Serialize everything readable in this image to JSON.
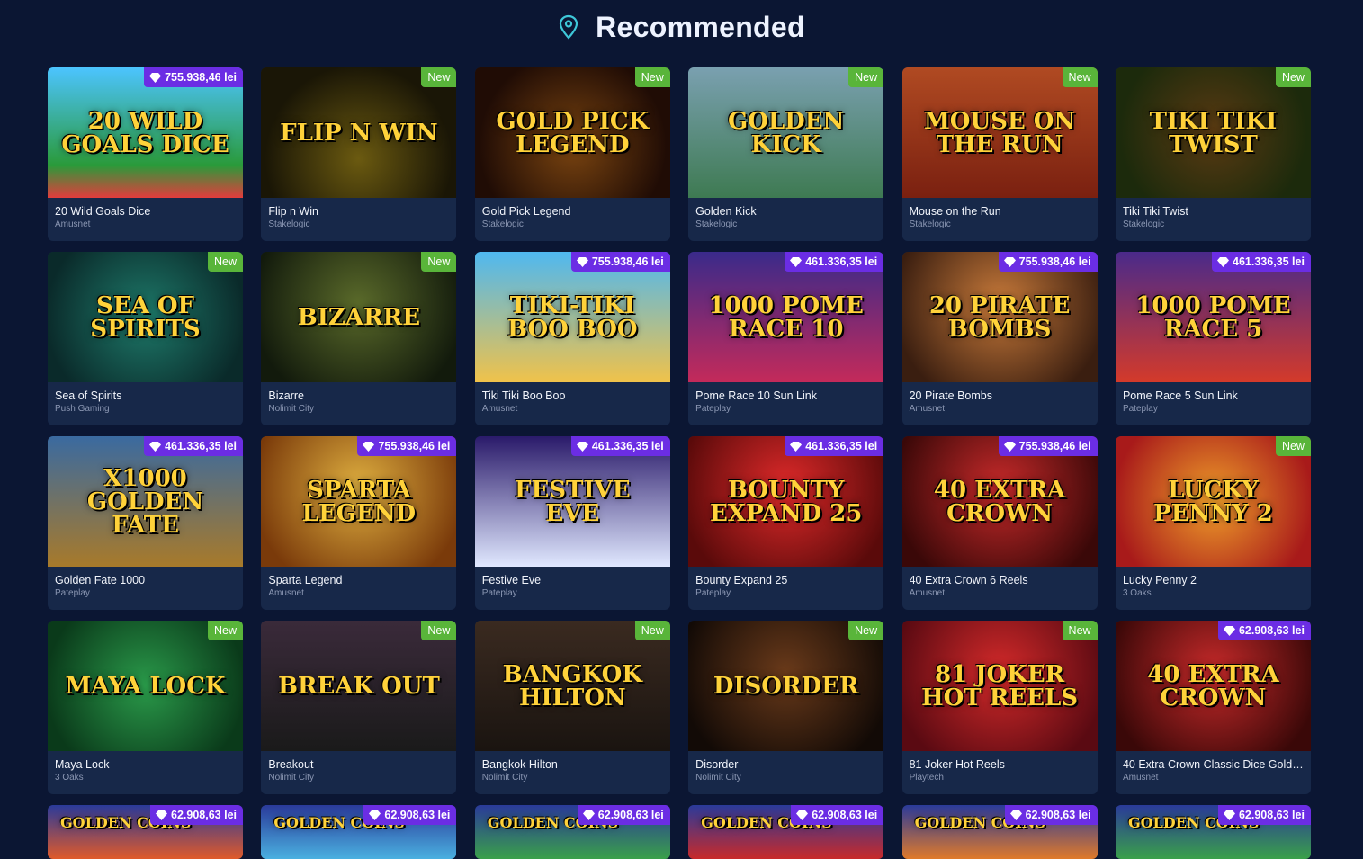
{
  "header": {
    "title": "Recommended",
    "icon": "location-pin-icon"
  },
  "colors": {
    "background": "#0b1633",
    "card": "#172849",
    "new_badge": "#59b53a",
    "jackpot_badge": "#6b2de4",
    "accent": "#3ec7d8"
  },
  "games": [
    {
      "title": "20 Wild Goals Dice",
      "provider": "Amusnet",
      "badge": "755.938,46 lei",
      "badge_type": "jackpot",
      "art": "20 Wild Goals Dice",
      "bg": "linear-gradient(180deg,#4cc4ff 0%,#2a9a3a 75%,#e23c3c 100%)"
    },
    {
      "title": "Flip n Win",
      "provider": "Stakelogic",
      "badge": "New",
      "badge_type": "new",
      "art": "Flip n Win",
      "bg": "radial-gradient(circle at 50% 70%,#6b5a10 0%,#1a1606 70%)"
    },
    {
      "title": "Gold Pick Legend",
      "provider": "Stakelogic",
      "badge": "New",
      "badge_type": "new",
      "art": "Gold Pick Legend",
      "bg": "radial-gradient(circle at 50% 60%,#7a4410 0%,#200c05 75%)"
    },
    {
      "title": "Golden Kick",
      "provider": "Stakelogic",
      "badge": "New",
      "badge_type": "new",
      "art": "Golden Kick",
      "bg": "linear-gradient(180deg,#7aa0b0 0%,#3e7a52 100%)"
    },
    {
      "title": "Mouse on the Run",
      "provider": "Stakelogic",
      "badge": "New",
      "badge_type": "new",
      "art": "Mouse on the Run",
      "bg": "linear-gradient(180deg,#b04a22 0%,#7a2010 100%)"
    },
    {
      "title": "Tiki Tiki Twist",
      "provider": "Stakelogic",
      "badge": "New",
      "badge_type": "new",
      "art": "Tiki Tiki Twist",
      "bg": "radial-gradient(circle at 50% 50%,#5a3a12 0%,#1c2a0c 80%)"
    },
    {
      "title": "Sea of Spirits",
      "provider": "Push Gaming",
      "badge": "New",
      "badge_type": "new",
      "art": "Sea of Spirits",
      "bg": "radial-gradient(circle at 50% 50%,#1e7a6a 0%,#0a2a2a 85%)"
    },
    {
      "title": "Bizarre",
      "provider": "Nolimit City",
      "badge": "New",
      "badge_type": "new",
      "art": "Bizarre",
      "bg": "radial-gradient(circle at 50% 40%,#5a6a2a 0%,#121a0c 85%)"
    },
    {
      "title": "Tiki Tiki Boo Boo",
      "provider": "Amusnet",
      "badge": "755.938,46 lei",
      "badge_type": "jackpot",
      "art": "Tiki-Tiki Boo Boo",
      "bg": "linear-gradient(180deg,#4fb8f0 0%,#f0c24a 100%)"
    },
    {
      "title": "Pome Race 10 Sun Link",
      "provider": "Pateplay",
      "badge": "461.336,35 lei",
      "badge_type": "jackpot",
      "art": "1000 Pome Race 10",
      "bg": "linear-gradient(180deg,#3a2a8a 0%,#c42a5a 100%)"
    },
    {
      "title": "20 Pirate Bombs",
      "provider": "Amusnet",
      "badge": "755.938,46 lei",
      "badge_type": "jackpot",
      "art": "20 Pirate Bombs",
      "bg": "radial-gradient(circle at 50% 40%,#c87a3a 0%,#3a1e10 85%)"
    },
    {
      "title": "Pome Race 5 Sun Link",
      "provider": "Pateplay",
      "badge": "461.336,35 lei",
      "badge_type": "jackpot",
      "art": "1000 Pome Race 5",
      "bg": "linear-gradient(180deg,#4a2a8a 0%,#d43a2a 100%)"
    },
    {
      "title": "Golden Fate 1000",
      "provider": "Pateplay",
      "badge": "461.336,35 lei",
      "badge_type": "jackpot",
      "art": "x1000 Golden Fate",
      "bg": "linear-gradient(180deg,#3a6aa0 0%,#a87a2a 100%)"
    },
    {
      "title": "Sparta Legend",
      "provider": "Amusnet",
      "badge": "755.938,46 lei",
      "badge_type": "jackpot",
      "art": "Sparta Legend",
      "bg": "radial-gradient(circle at 50% 40%,#e0b040 0%,#7a3a0a 85%)"
    },
    {
      "title": "Festive Eve",
      "provider": "Pateplay",
      "badge": "461.336,35 lei",
      "badge_type": "jackpot",
      "art": "Festive Eve",
      "bg": "linear-gradient(180deg,#2a1a6a 0%,#e0e8ff 100%)"
    },
    {
      "title": "Bounty Expand 25",
      "provider": "Pateplay",
      "badge": "461.336,35 lei",
      "badge_type": "jackpot",
      "art": "Bounty Expand 25",
      "bg": "radial-gradient(circle at 50% 40%,#e02a2a 0%,#5a0a0a 85%)"
    },
    {
      "title": "40 Extra Crown 6 Reels",
      "provider": "Amusnet",
      "badge": "755.938,46 lei",
      "badge_type": "jackpot",
      "art": "40 Extra Crown",
      "bg": "radial-gradient(circle at 50% 40%,#c82a2a 0%,#3a0808 85%)"
    },
    {
      "title": "Lucky Penny 2",
      "provider": "3 Oaks",
      "badge": "New",
      "badge_type": "new",
      "art": "Lucky Penny 2",
      "bg": "radial-gradient(circle at 50% 50%,#f0a02a 0%,#a81a1a 85%)"
    },
    {
      "title": "Maya Lock",
      "provider": "3 Oaks",
      "badge": "New",
      "badge_type": "new",
      "art": "Maya Lock",
      "bg": "radial-gradient(circle at 50% 50%,#2a9a4a 0%,#0a3a1a 85%)"
    },
    {
      "title": "Breakout",
      "provider": "Nolimit City",
      "badge": "New",
      "badge_type": "new",
      "art": "Break Out",
      "bg": "linear-gradient(180deg,#3a2a3a 0%,#1a1a1a 100%)"
    },
    {
      "title": "Bangkok Hilton",
      "provider": "Nolimit City",
      "badge": "New",
      "badge_type": "new",
      "art": "Bangkok Hilton",
      "bg": "linear-gradient(180deg,#3a2a20 0%,#1a1410 100%)"
    },
    {
      "title": "Disorder",
      "provider": "Nolimit City",
      "badge": "New",
      "badge_type": "new",
      "art": "Disorder",
      "bg": "radial-gradient(circle at 50% 40%,#6a3a1a 0%,#120a06 85%)"
    },
    {
      "title": "81 Joker Hot Reels",
      "provider": "Playtech",
      "badge": "New",
      "badge_type": "new",
      "art": "81 Joker Hot Reels",
      "bg": "radial-gradient(circle at 50% 40%,#d42a2a 0%,#5a0a12 85%)"
    },
    {
      "title": "40 Extra Crown Classic Dice Golde...",
      "provider": "Amusnet",
      "badge": "62.908,63 lei",
      "badge_type": "jackpot",
      "art": "40 Extra Crown",
      "bg": "radial-gradient(circle at 50% 40%,#c82a2a 0%,#3a0808 85%)"
    },
    {
      "title": "",
      "provider": "",
      "badge": "62.908,63 lei",
      "badge_type": "jackpot",
      "art": "Golden Coins",
      "bg": "linear-gradient(180deg,#2a3a9a 0%,#e05a2a 100%)"
    },
    {
      "title": "",
      "provider": "",
      "badge": "62.908,63 lei",
      "badge_type": "jackpot",
      "art": "Golden Coins",
      "bg": "linear-gradient(180deg,#2a3a9a 0%,#4ab0e0 100%)"
    },
    {
      "title": "",
      "provider": "",
      "badge": "62.908,63 lei",
      "badge_type": "jackpot",
      "art": "Golden Coins",
      "bg": "linear-gradient(180deg,#2a3a9a 0%,#3aa04a 100%)"
    },
    {
      "title": "",
      "provider": "",
      "badge": "62.908,63 lei",
      "badge_type": "jackpot",
      "art": "Golden Coins",
      "bg": "linear-gradient(180deg,#2a3a9a 0%,#c82a2a 100%)"
    },
    {
      "title": "",
      "provider": "",
      "badge": "62.908,63 lei",
      "badge_type": "jackpot",
      "art": "Golden Coins",
      "bg": "linear-gradient(180deg,#2a3a9a 0%,#e07a2a 100%)"
    },
    {
      "title": "",
      "provider": "",
      "badge": "62.908,63 lei",
      "badge_type": "jackpot",
      "art": "Golden Coins",
      "bg": "linear-gradient(180deg,#2a3a9a 0%,#3aa04a 100%)"
    }
  ]
}
